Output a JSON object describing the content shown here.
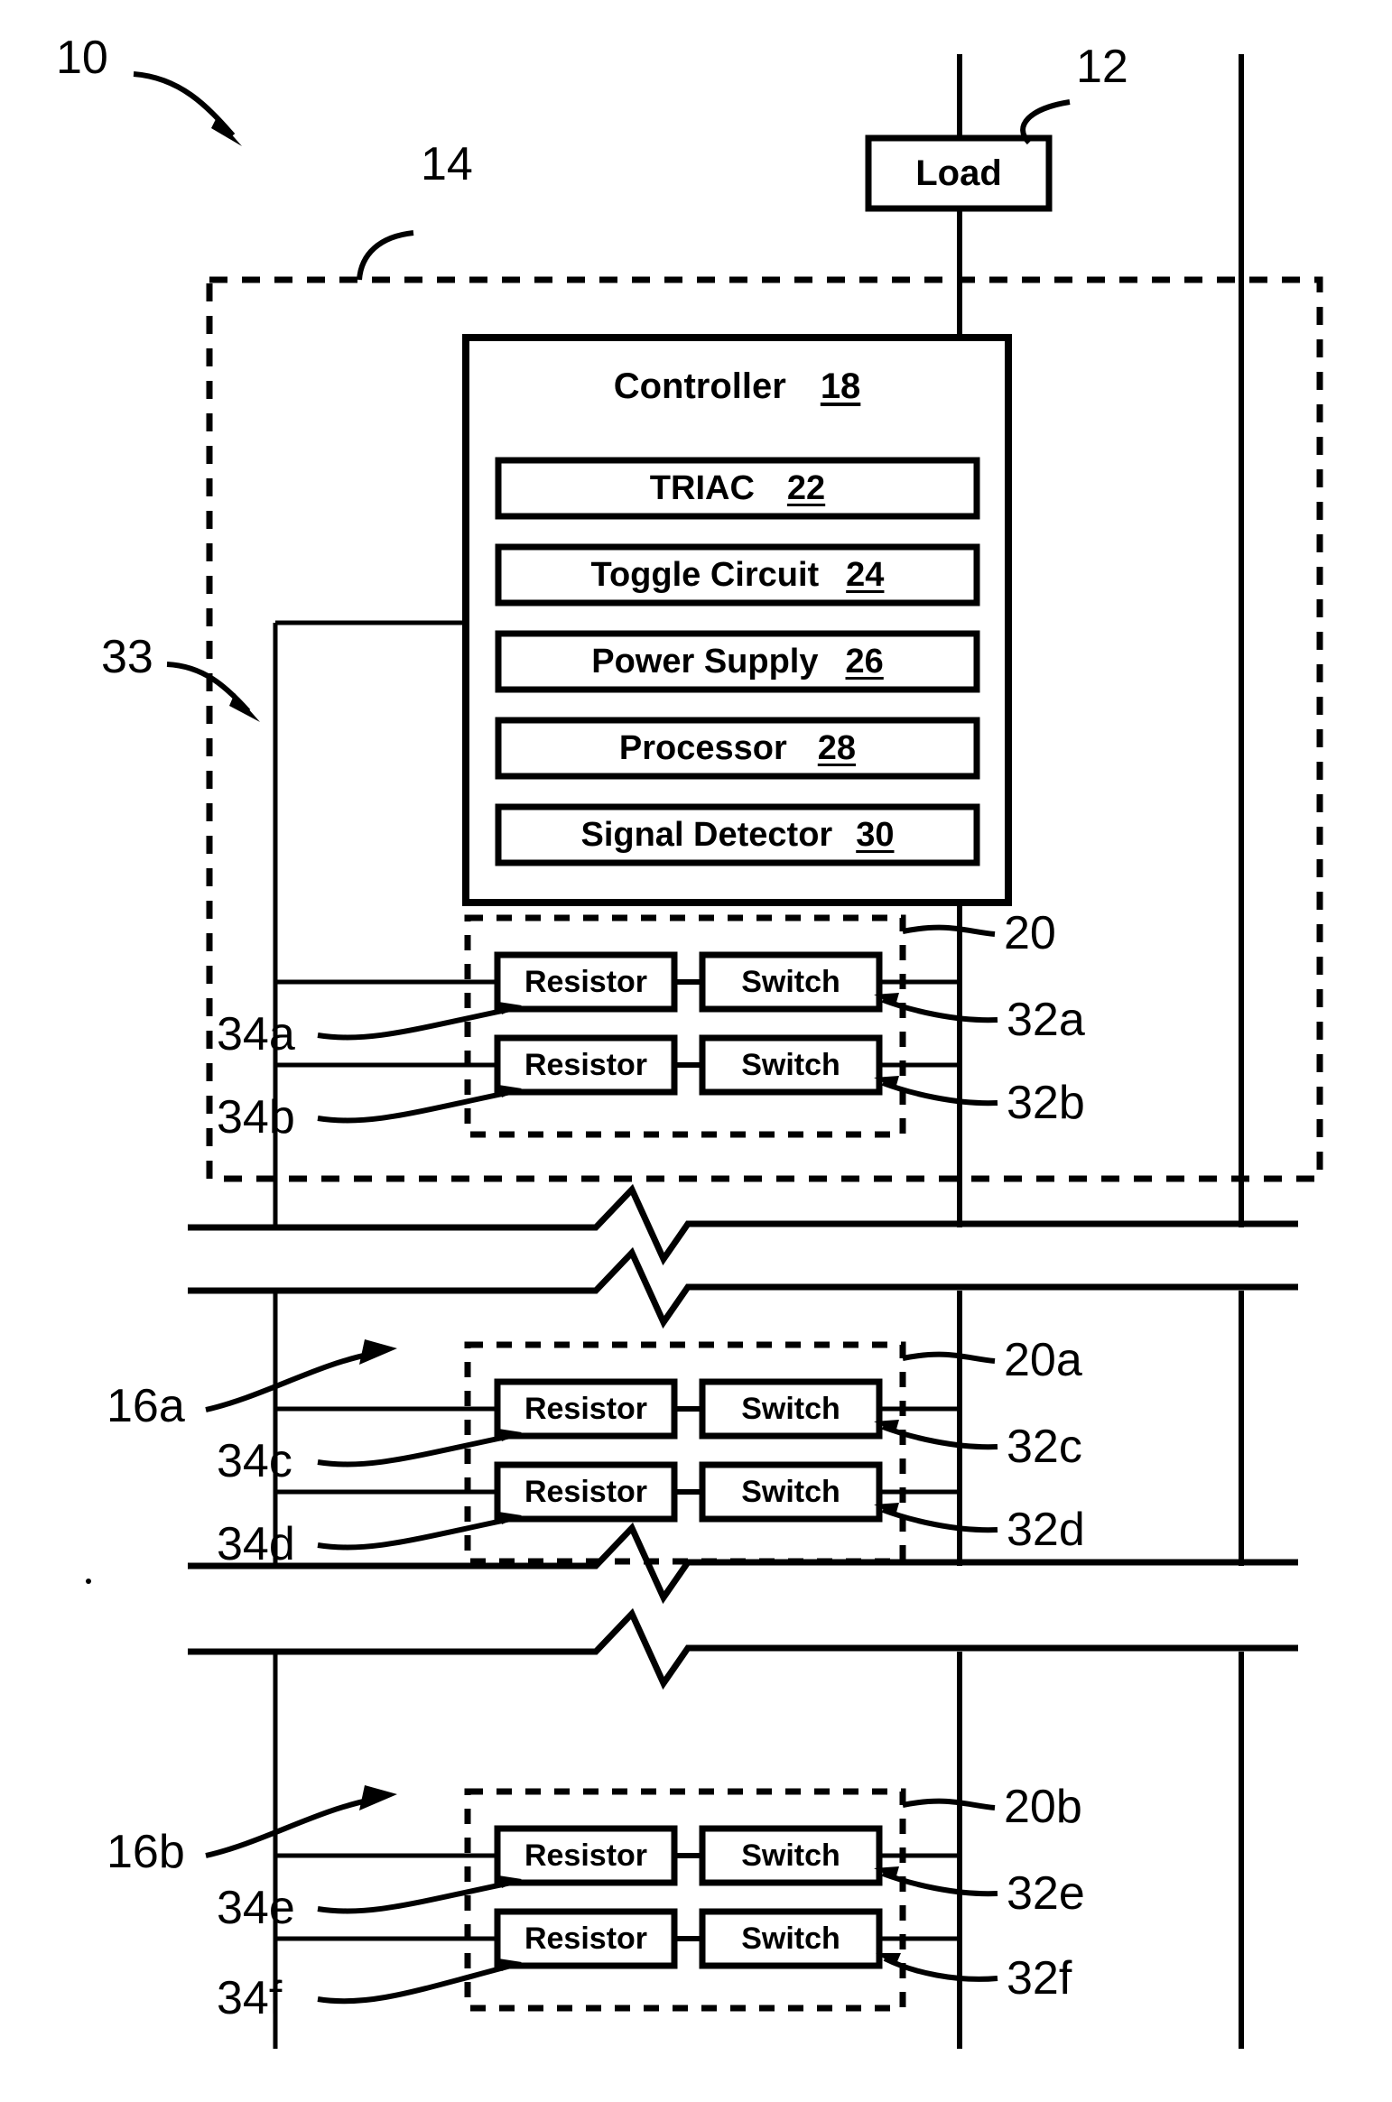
{
  "figure": {
    "type": "patent-block-diagram",
    "system_label": "10",
    "load": {
      "label": "Load",
      "ref": "12"
    },
    "enclosure": {
      "ref": "14",
      "style": "dashed"
    },
    "bus_ref": "33",
    "controller": {
      "title": "Controller",
      "ref": "18",
      "blocks": [
        {
          "label": "TRIAC",
          "ref": "22"
        },
        {
          "label": "Toggle Circuit",
          "ref": "24"
        },
        {
          "label": "Power Supply",
          "ref": "26"
        },
        {
          "label": "Processor",
          "ref": "28"
        },
        {
          "label": "Signal Detector",
          "ref": "30"
        }
      ]
    },
    "groups": [
      {
        "ref": "20",
        "station_ref": "",
        "rows": [
          {
            "resistor": "Resistor",
            "resistor_ref": "34a",
            "switch": "Switch",
            "switch_ref": "32a"
          },
          {
            "resistor": "Resistor",
            "resistor_ref": "34b",
            "switch": "Switch",
            "switch_ref": "32b"
          }
        ]
      },
      {
        "ref": "20a",
        "station_ref": "16a",
        "rows": [
          {
            "resistor": "Resistor",
            "resistor_ref": "34c",
            "switch": "Switch",
            "switch_ref": "32c"
          },
          {
            "resistor": "Resistor",
            "resistor_ref": "34d",
            "switch": "Switch",
            "switch_ref": "32d"
          }
        ]
      },
      {
        "ref": "20b",
        "station_ref": "16b",
        "rows": [
          {
            "resistor": "Resistor",
            "resistor_ref": "34e",
            "switch": "Switch",
            "switch_ref": "32e"
          },
          {
            "resistor": "Resistor",
            "resistor_ref": "34f",
            "switch": "Switch",
            "switch_ref": "32f"
          }
        ]
      }
    ],
    "colors": {
      "ink": "#000000",
      "paper": "#ffffff"
    }
  }
}
